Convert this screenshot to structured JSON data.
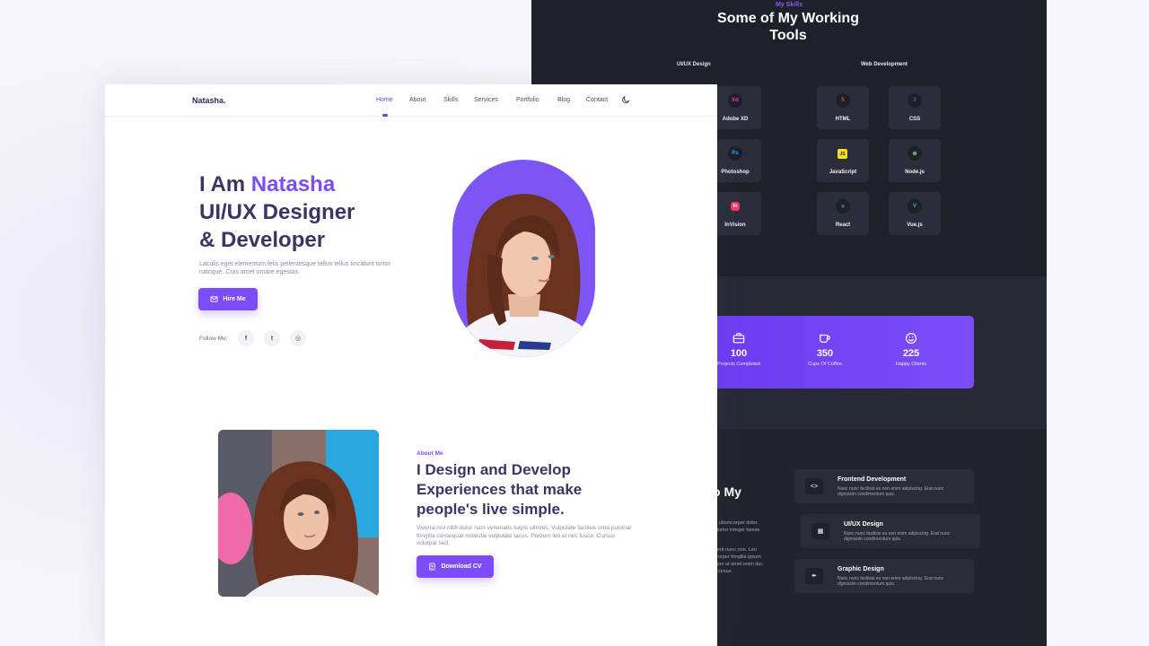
{
  "dark": {
    "skills_kicker": "My Skills",
    "skills_title": "Some of My Working Tools",
    "col_uiux": "UI/UX Design",
    "col_web": "Web Development",
    "uiux_tools": [
      "Adobe XD",
      "Photoshop",
      "InVision"
    ],
    "uiux_badges": [
      "Xd",
      "Ps",
      "In"
    ],
    "web_tools": [
      "HTML",
      "CSS",
      "JavaScript",
      "Node.js",
      "React",
      "Vue.js"
    ],
    "web_badges": [
      "5",
      "3",
      "JS",
      "⬢",
      "⚛",
      "V"
    ],
    "stats": [
      {
        "num": "100",
        "cap": "Projects Completed",
        "icon": "briefcase-icon"
      },
      {
        "num": "350",
        "cap": "Cups Of Coffee",
        "icon": "coffee-icon"
      },
      {
        "num": "225",
        "cap": "Happy Clients",
        "icon": "smile-icon"
      }
    ],
    "about_title": "o My",
    "about_lines": [
      "tis ullamcorper dolor.",
      "a tortor integer fames",
      "drerit nunc non. Leo",
      "ncorper fringilla ipsum",
      "mpor ut amet enim dui.",
      "s cursus."
    ],
    "services": [
      {
        "title": "Frontend Development",
        "desc": "Nunc nunc facilisis eu non enim adipiscing. Erat nunc dignissim condimentum quis.",
        "icon": "code-icon"
      },
      {
        "title": "UI/UX Design",
        "desc": "Nunc nunc facilisis eu non enim adipiscing. Erat nunc dignissim condimentum quis.",
        "icon": "layout-icon"
      },
      {
        "title": "Graphic Design",
        "desc": "Nunc nunc facilisis eu non enim adipiscing. Erat nunc dignissim condimentum quis.",
        "icon": "pen-tool-icon"
      }
    ]
  },
  "light": {
    "logo": "Natasha.",
    "nav": [
      "Home",
      "About",
      "Skills",
      "Services",
      "Portfolio",
      "Blog",
      "Contact"
    ],
    "hero": {
      "line1_prefix": "I Am ",
      "line1_name": "Natasha",
      "line2": "UI/UX Designer",
      "line3": "& Developer",
      "text": "Laculis eget elementum felis pellentesque tellus tellus tincidunt tortor natoque. Cras amet ornare egestas.",
      "button": "Hire Me",
      "follow_label": "Follow Me:",
      "socials": [
        "f",
        "t",
        "◎"
      ]
    },
    "about": {
      "kicker": "About Me",
      "title": "I Design and Develop Experiences that make people's live simple.",
      "text": "Viverra nisl nibh dolor nam venenatis turpis ultrices. Vulputate facilisis urna pulvinar fringilla consequat molestie vulputate lacus. Pretium leo et nec fusce. Cursus volutpat sed.",
      "button": "Download CV"
    }
  },
  "colors": {
    "accent": "#7c4df7",
    "dark_bg": "#23252f",
    "heading": "#3b3566"
  }
}
